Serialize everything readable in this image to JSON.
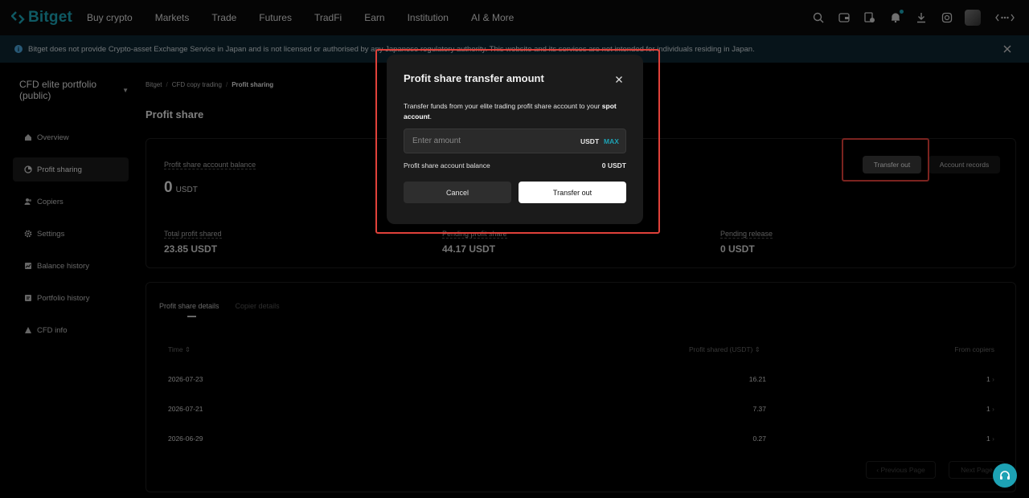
{
  "nav": {
    "logo_text": "Bitget",
    "items": [
      "Buy crypto",
      "Markets",
      "Trade",
      "Futures",
      "TradFi",
      "Earn",
      "Institution",
      "AI & More"
    ]
  },
  "notice": {
    "text": "Bitget does not provide Crypto-asset Exchange Service in Japan and is not licensed or authorised by any Japanese regulatory authority. This website and its services are not intended for individuals residing in Japan."
  },
  "sidebar": {
    "portfolio_label": "CFD elite portfolio (public)",
    "items": [
      {
        "label": "Overview",
        "icon": "home-icon"
      },
      {
        "label": "Profit sharing",
        "icon": "pie-chart-icon"
      },
      {
        "label": "Copiers",
        "icon": "users-icon"
      },
      {
        "label": "Settings",
        "icon": "gear-icon"
      },
      {
        "label": "Balance history",
        "icon": "chart-icon"
      },
      {
        "label": "Portfolio history",
        "icon": "history-icon"
      },
      {
        "label": "CFD info",
        "icon": "info-icon"
      }
    ]
  },
  "breadcrumb": {
    "items": [
      "Bitget",
      "CFD copy trading",
      "Profit sharing"
    ]
  },
  "page_title": "Profit share",
  "balance_card": {
    "label": "Profit share account balance",
    "value": "0",
    "unit": "USDT",
    "transfer_label": "Transfer out",
    "records_label": "Account records",
    "stats": [
      {
        "label": "Total profit shared",
        "value": "23.85 USDT"
      },
      {
        "label": "Pending profit share",
        "value": "44.17 USDT"
      },
      {
        "label": "Pending release",
        "value": "0 USDT"
      }
    ]
  },
  "details": {
    "tabs": [
      "Profit share details",
      "Copier details"
    ],
    "columns": [
      "Time",
      "Profit shared (USDT)",
      "From copiers"
    ],
    "rows": [
      {
        "time": "2026-07-23",
        "profit": "16.21",
        "copiers": "1"
      },
      {
        "time": "2026-07-21",
        "profit": "7.37",
        "copiers": "1"
      },
      {
        "time": "2026-06-29",
        "profit": "0.27",
        "copiers": "1"
      }
    ],
    "prev_label": "Previous Page",
    "next_label": "Next Page"
  },
  "modal": {
    "title": "Profit share transfer amount",
    "desc_text": "Transfer funds from your elite trading profit share account to your",
    "desc_bold": "spot account",
    "desc_end": ".",
    "input_placeholder": "Enter amount",
    "input_unit": "USDT",
    "max_label": "MAX",
    "balance_label": "Profit share account balance",
    "balance_value": "0 USDT",
    "cancel_label": "Cancel",
    "confirm_label": "Transfer out"
  },
  "colors": {
    "accent": "#1da2b4",
    "highlight": "#e0413a"
  }
}
